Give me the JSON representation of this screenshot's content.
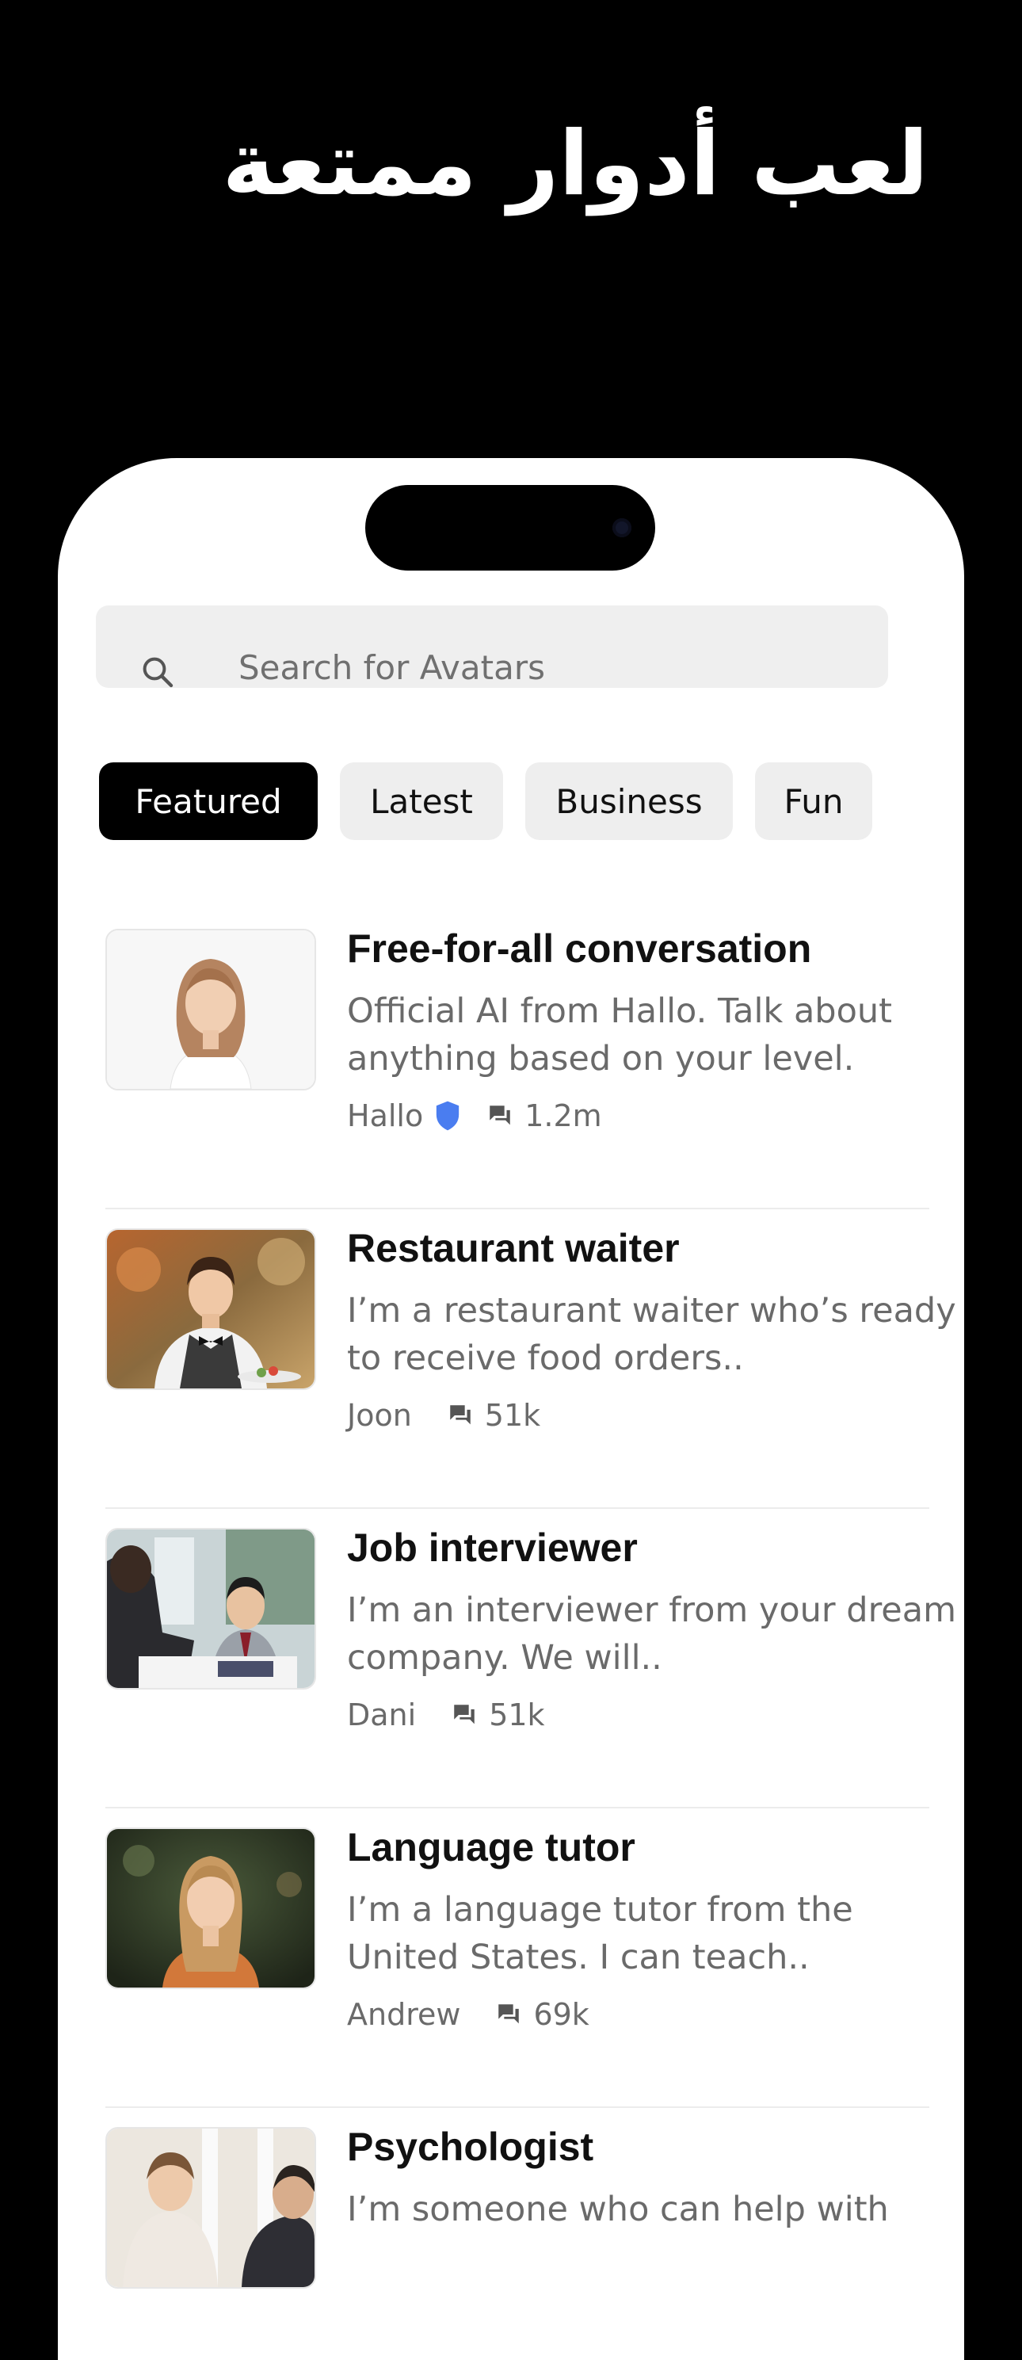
{
  "headline": "لعب أدوار ممتعة",
  "search": {
    "placeholder": "Search for Avatars"
  },
  "tabs": [
    {
      "label": "Featured",
      "active": true
    },
    {
      "label": "Latest",
      "active": false
    },
    {
      "label": "Business",
      "active": false
    },
    {
      "label": "Fun",
      "active": false
    }
  ],
  "items": [
    {
      "title": "Free-for-all conversation",
      "description": "Official AI from Hallo. Talk about anything based on your level.",
      "author": "Hallo",
      "verified": true,
      "chats": "1.2m"
    },
    {
      "title": "Restaurant waiter",
      "description": "I’m a restaurant waiter who’s ready to receive food orders..",
      "author": "Joon",
      "verified": false,
      "chats": "51k"
    },
    {
      "title": "Job interviewer",
      "description": "I’m an interviewer from your dream company. We will..",
      "author": "Dani",
      "verified": false,
      "chats": "51k"
    },
    {
      "title": "Language tutor",
      "description": "I’m a language tutor from the United States. I can teach..",
      "author": "Andrew",
      "verified": false,
      "chats": "69k"
    },
    {
      "title": "Psychologist",
      "description": "I’m someone who can help with",
      "author": "",
      "verified": false,
      "chats": ""
    }
  ],
  "colors": {
    "verified_badge": "#4a7df0",
    "active_tab_bg": "#000000",
    "tab_bg": "#eeeeee"
  }
}
